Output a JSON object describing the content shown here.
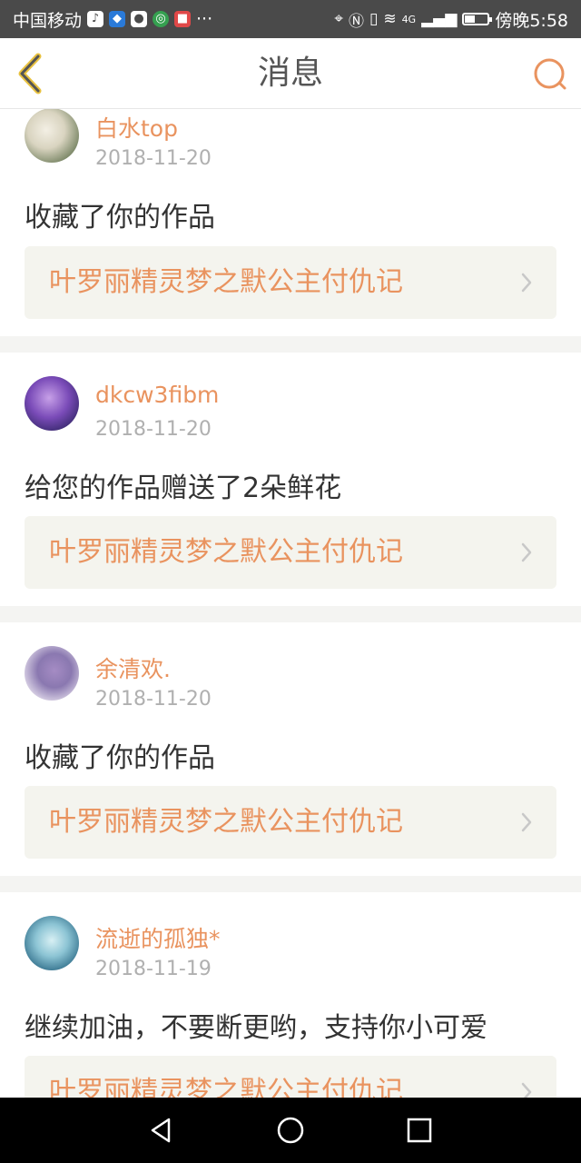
{
  "status_bar": {
    "carrier": "中国移动",
    "dots": "···",
    "network": "4G",
    "time": "傍晚5:58",
    "battery_level": 0.4
  },
  "header": {
    "title": "消息"
  },
  "messages": [
    {
      "username": "白水top",
      "date": "2018-11-20",
      "text": "收藏了你的作品",
      "work_title": "叶罗丽精灵梦之默公主付仇记"
    },
    {
      "username": "dkcw3fibm",
      "date": "2018-11-20",
      "text": "给您的作品赠送了2朵鲜花",
      "work_title": "叶罗丽精灵梦之默公主付仇记"
    },
    {
      "username": "余清欢.",
      "date": "2018-11-20",
      "text": "收藏了你的作品",
      "work_title": "叶罗丽精灵梦之默公主付仇记"
    },
    {
      "username": "流逝的孤独*",
      "date": "2018-11-19",
      "text": "继续加油，不要断更哟，支持你小可爱",
      "work_title": "叶罗丽精灵梦之默公主付仇记"
    }
  ],
  "colors": {
    "accent": "#e9935f",
    "status_bar": "#4a4a4a",
    "divider": "#f4f4f2",
    "link_bg": "#f4f4ee"
  },
  "icons": {
    "back": "chevron-left-icon",
    "search": "search-icon",
    "nav_back": "triangle-back-icon",
    "nav_home": "circle-home-icon",
    "nav_recents": "square-recents-icon"
  }
}
